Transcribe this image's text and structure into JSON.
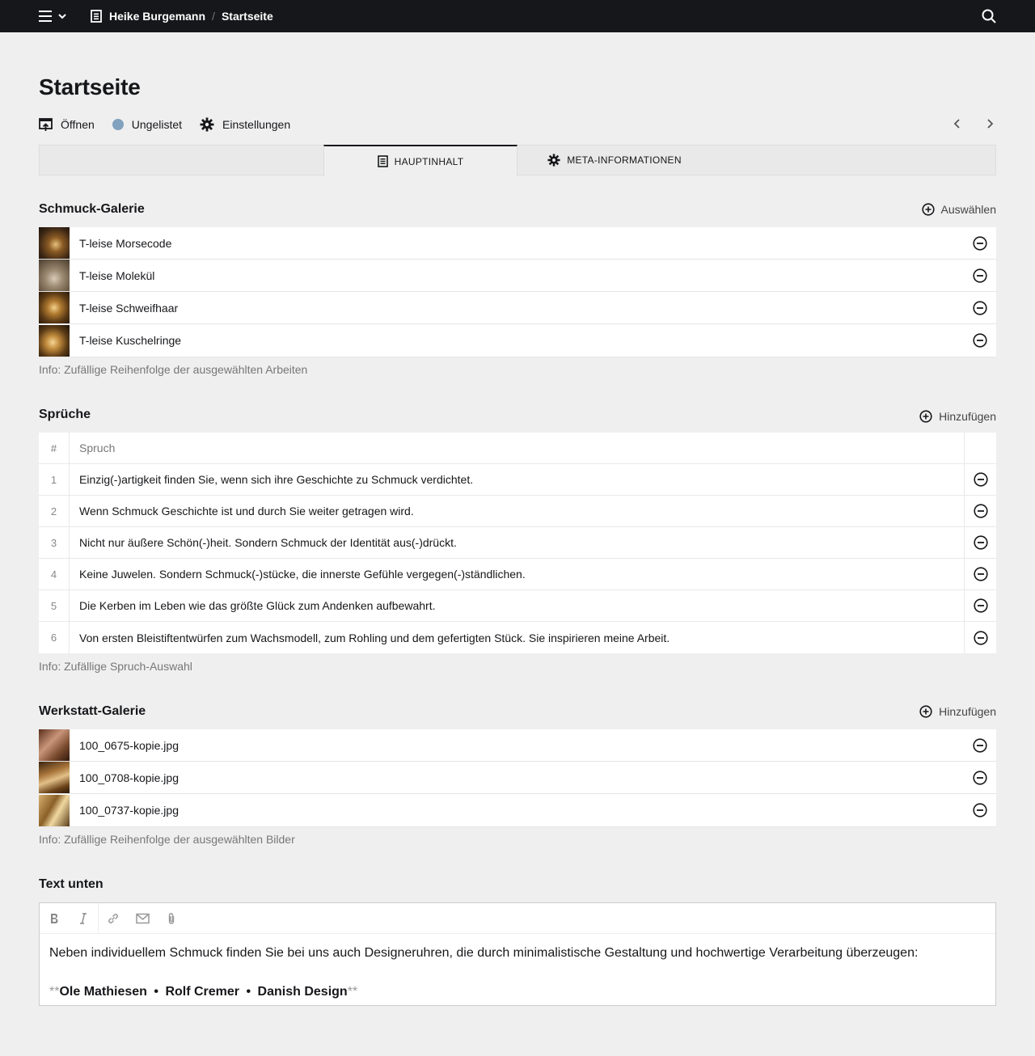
{
  "topbar": {
    "site_name": "Heike Burgemann",
    "separator": "/",
    "current_page": "Startseite"
  },
  "page": {
    "title": "Startseite",
    "actions": {
      "open_label": "Öffnen",
      "status_label": "Ungelistet",
      "settings_label": "Einstellungen"
    },
    "status_color": "#81a2be"
  },
  "tabs": [
    {
      "label": "HAUPTINHALT",
      "icon": "page-icon",
      "active": true
    },
    {
      "label": "META-INFORMATIONEN",
      "icon": "gear-icon",
      "active": false
    }
  ],
  "schmuck_galerie": {
    "title": "Schmuck-Galerie",
    "action_label": "Auswählen",
    "items": [
      {
        "label": "T-leise Morsecode"
      },
      {
        "label": "T-leise Molekül"
      },
      {
        "label": "T-leise Schweifhaar"
      },
      {
        "label": "T-leise Kuschelringe"
      }
    ],
    "help": "Info: Zufällige Reihenfolge der ausgewählten Arbeiten"
  },
  "sprueche": {
    "title": "Sprüche",
    "action_label": "Hinzufügen",
    "columns": [
      "#",
      "Spruch"
    ],
    "rows": [
      {
        "num": "1",
        "text": "Einzig(-)artigkeit finden Sie, wenn sich ihre Geschichte zu Schmuck verdichtet."
      },
      {
        "num": "2",
        "text": "Wenn Schmuck Geschichte ist und durch Sie weiter getragen wird."
      },
      {
        "num": "3",
        "text": "Nicht nur äußere Schön(-)heit. Sondern Schmuck der Identität aus(-)drückt."
      },
      {
        "num": "4",
        "text": "Keine Juwelen. Sondern Schmuck(-)stücke, die innerste Gefühle vergegen(-)ständlichen."
      },
      {
        "num": "5",
        "text": "Die Kerben im Leben wie das größte Glück zum Andenken aufbewahrt."
      },
      {
        "num": "6",
        "text": "Von ersten Bleistiftentwürfen zum Wachsmodell, zum Rohling und dem gefertigten Stück. Sie inspirieren meine Arbeit."
      }
    ],
    "help": "Info: Zufällige Spruch-Auswahl"
  },
  "werkstatt_galerie": {
    "title": "Werkstatt-Galerie",
    "action_label": "Hinzufügen",
    "items": [
      {
        "label": "100_0675-kopie.jpg"
      },
      {
        "label": "100_0708-kopie.jpg"
      },
      {
        "label": "100_0737-kopie.jpg"
      }
    ],
    "help": "Info: Zufällige Reihenfolge der ausgewählten Bilder"
  },
  "text_unten": {
    "title": "Text unten",
    "toolbar": [
      "bold-icon",
      "italic-icon",
      "link-icon",
      "email-icon",
      "attachment-icon"
    ],
    "paragraph": "Neben individuellem Schmuck finden Sie bei uns auch Designeruhren, die durch  minimalistische Gestaltung und hochwertige Verarbeitung überzeugen:",
    "md_marker": "**",
    "brands": [
      "Ole Mathiesen",
      "Rolf Cremer",
      "Danish Design"
    ],
    "brand_separator": "•"
  }
}
